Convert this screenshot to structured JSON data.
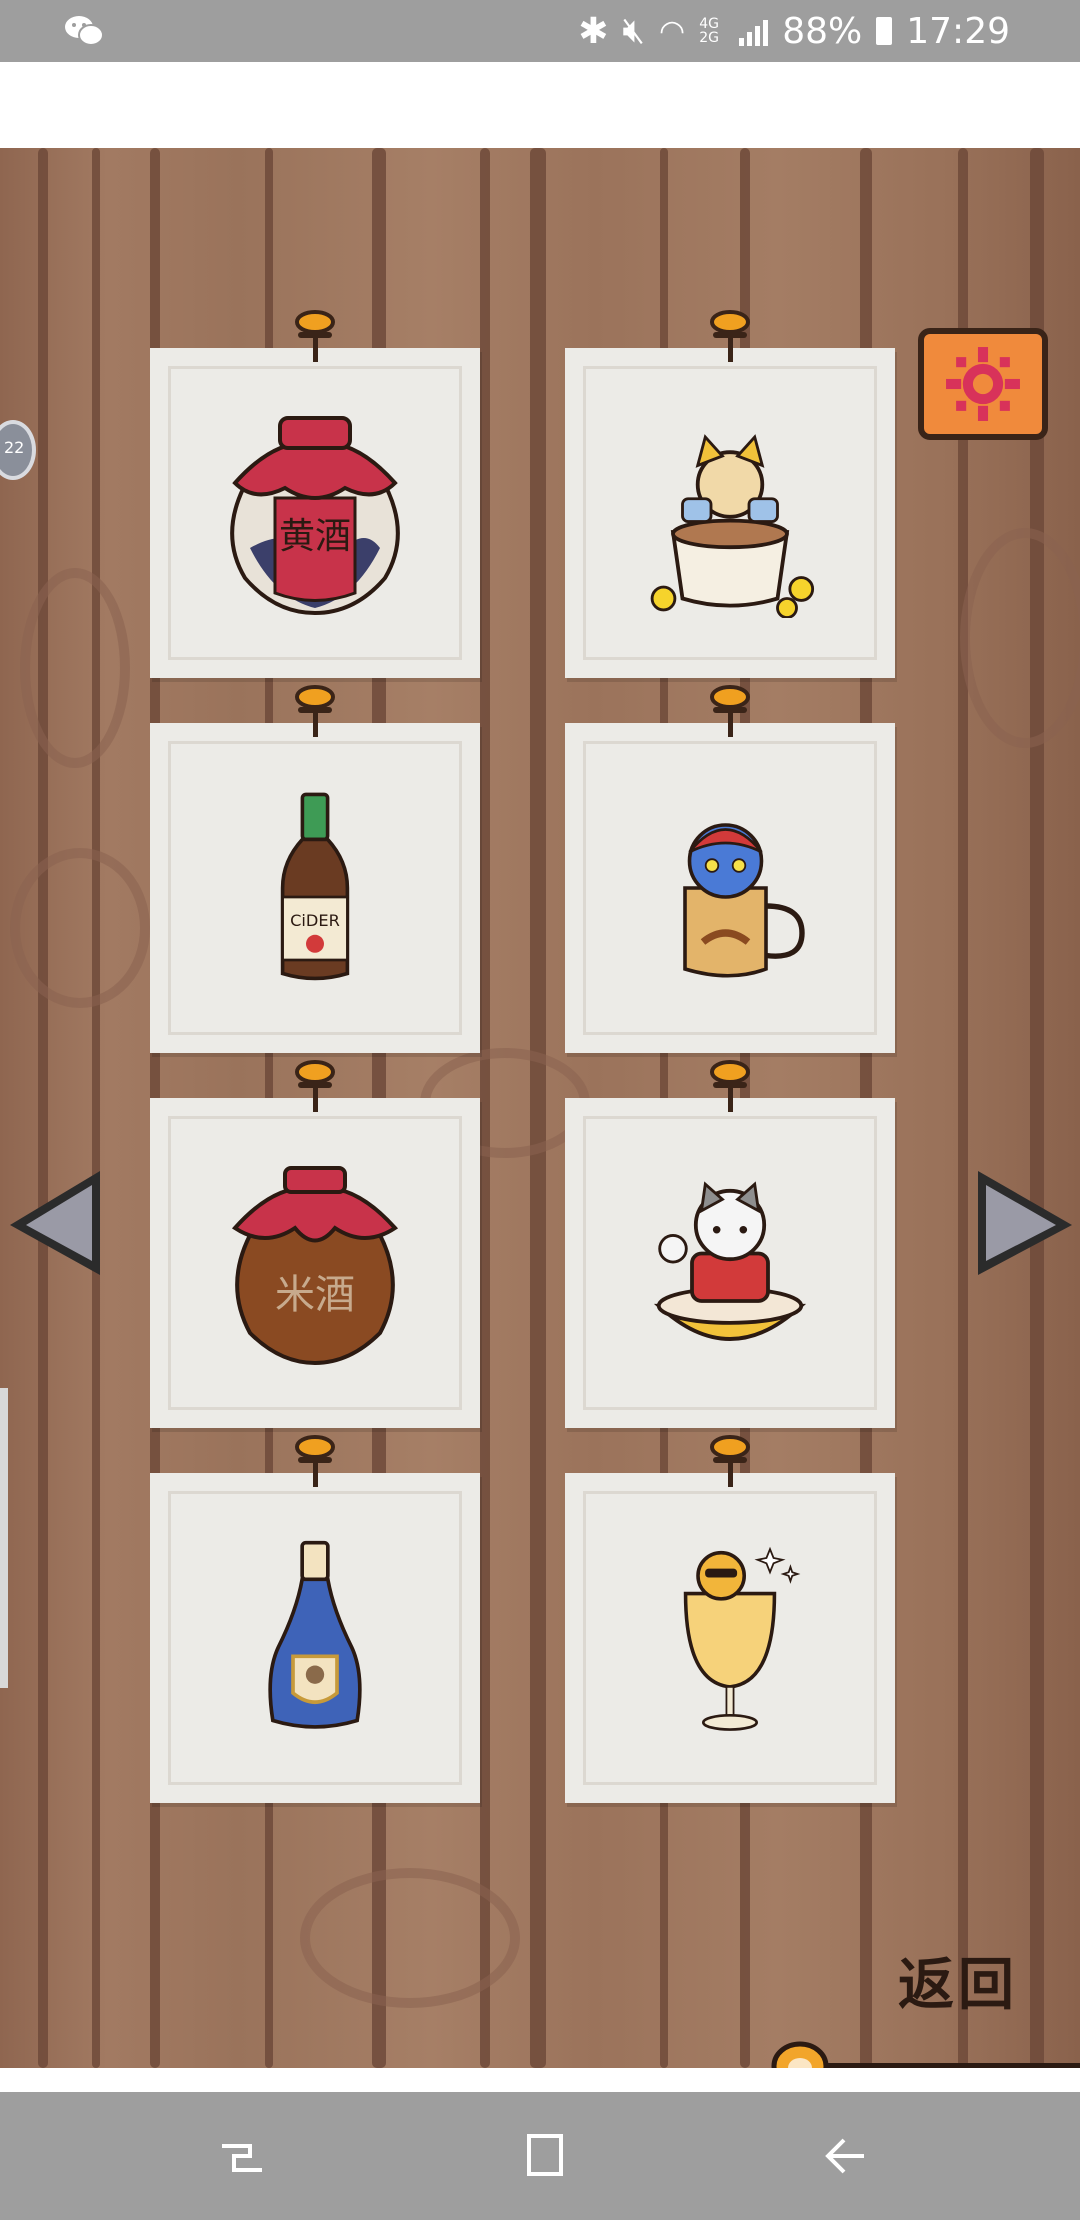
{
  "status_bar": {
    "battery_percent": "88%",
    "time": "17:29",
    "network": "4G 2G"
  },
  "game": {
    "side_badge": "22",
    "back_button_label": "返回",
    "cards": [
      {
        "icon": "yellow-wine-jar-icon",
        "jar_text": "黄酒"
      },
      {
        "icon": "cat-in-gold-cup-icon"
      },
      {
        "icon": "cider-bottle-icon",
        "label_text": "CiDER"
      },
      {
        "icon": "cat-in-beer-mug-icon"
      },
      {
        "icon": "rice-wine-jar-icon",
        "jar_text": "米酒"
      },
      {
        "icon": "cat-in-porridge-bowl-icon"
      },
      {
        "icon": "blue-liquor-bottle-icon"
      },
      {
        "icon": "cat-in-champagne-glass-icon"
      }
    ]
  },
  "colors": {
    "wood": "#a27a62",
    "wood_dark": "#6e4a3a",
    "card": "#ecebe7",
    "settings_orange": "#f08a3c",
    "paw_orange": "#f2a52a",
    "system_bar": "#9e9e9e"
  }
}
